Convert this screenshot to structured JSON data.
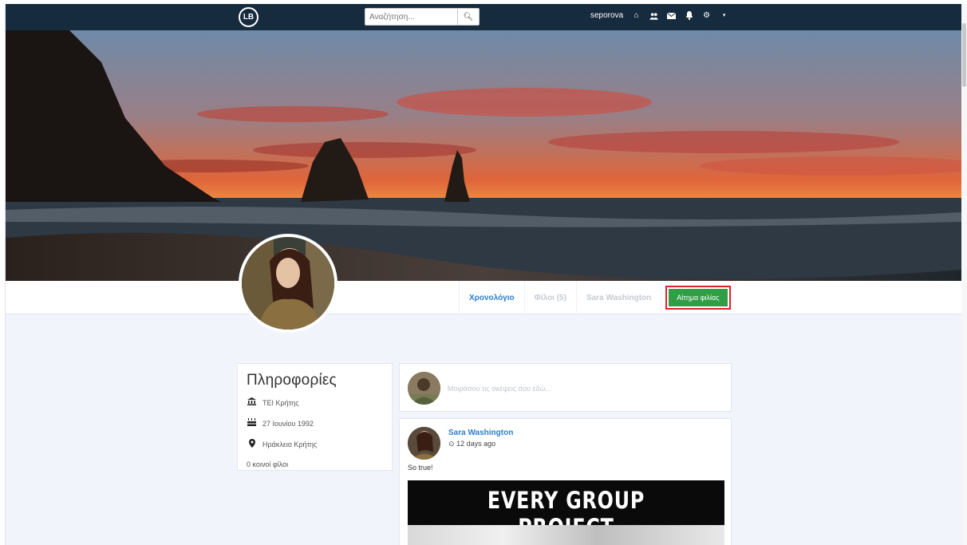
{
  "header": {
    "logo_text": "LB",
    "search_placeholder": "Αναζήτηση...",
    "search_button_icon": "search-icon",
    "username": "seporova",
    "icons": [
      "home-icon",
      "users-icon",
      "envelope-icon",
      "bell-icon",
      "gear-icon",
      "caret-down-icon"
    ]
  },
  "profile": {
    "tabs": [
      {
        "label": "Χρονολόγιο",
        "active": true
      },
      {
        "label": "Φίλοι (5)",
        "active": false
      },
      {
        "label": "Sara Washington",
        "active": false
      }
    ],
    "friend_request_label": "Αίτημα φιλίας"
  },
  "info": {
    "title": "Πληροφορίες",
    "school": "ΤΕΙ Κρήτης",
    "birthday": "27 Ιουνίου 1992",
    "location": "Ηράκλειο Κρήτης",
    "mutual_friends": "0 κοινοί φίλοι"
  },
  "composer": {
    "placeholder": "Μοιράσου τις σκέψεις σου εδώ..."
  },
  "post": {
    "author": "Sara Washington",
    "time": "12 days ago",
    "text": "So true!",
    "image_caption": "EVERY GROUP PROJECT"
  },
  "colors": {
    "topbar": "#172b3f",
    "accent": "#2a7fd4",
    "button_green": "#2f9e45",
    "highlight_border": "#d9232d"
  }
}
